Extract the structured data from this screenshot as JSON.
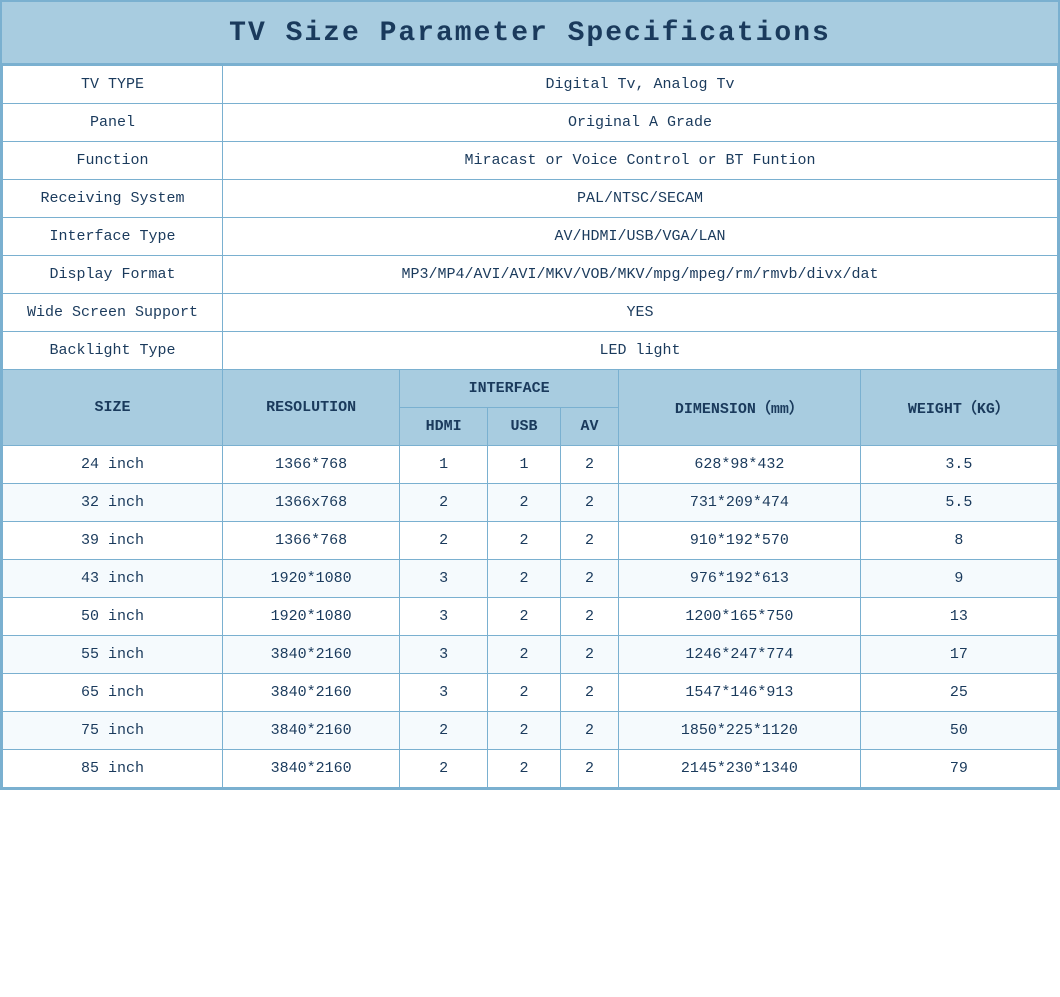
{
  "title": "TV Size Parameter Specifications",
  "specs": [
    {
      "label": "TV TYPE",
      "value": "Digital Tv, Analog Tv"
    },
    {
      "label": "Panel",
      "value": "Original A Grade"
    },
    {
      "label": "Function",
      "value": "Miracast or Voice Control or BT Funtion"
    },
    {
      "label": "Receiving System",
      "value": "PAL/NTSC/SECAM"
    },
    {
      "label": "Interface Type",
      "value": "AV/HDMI/USB/VGA/LAN"
    },
    {
      "label": "Display Format",
      "value": "MP3/MP4/AVI/AVI/MKV/VOB/MKV/mpg/mpeg/rm/rmvb/divx/dat"
    },
    {
      "label": "Wide Screen Support",
      "value": "YES"
    },
    {
      "label": "Backlight Type",
      "value": "LED light"
    }
  ],
  "size_table": {
    "col_size": "SIZE",
    "col_resolution": "RESOLUTION",
    "col_interface": "INTERFACE",
    "col_hdmi": "HDMI",
    "col_usb": "USB",
    "col_av": "AV",
    "col_dimension": "DIMENSION（mm）",
    "col_weight": "WEIGHT（KG）",
    "rows": [
      {
        "size": "24 inch",
        "resolution": "1366*768",
        "hdmi": "1",
        "usb": "1",
        "av": "2",
        "dimension": "628*98*432",
        "weight": "3.5"
      },
      {
        "size": "32 inch",
        "resolution": "1366x768",
        "hdmi": "2",
        "usb": "2",
        "av": "2",
        "dimension": "731*209*474",
        "weight": "5.5"
      },
      {
        "size": "39 inch",
        "resolution": "1366*768",
        "hdmi": "2",
        "usb": "2",
        "av": "2",
        "dimension": "910*192*570",
        "weight": "8"
      },
      {
        "size": "43 inch",
        "resolution": "1920*1080",
        "hdmi": "3",
        "usb": "2",
        "av": "2",
        "dimension": "976*192*613",
        "weight": "9"
      },
      {
        "size": "50 inch",
        "resolution": "1920*1080",
        "hdmi": "3",
        "usb": "2",
        "av": "2",
        "dimension": "1200*165*750",
        "weight": "13"
      },
      {
        "size": "55 inch",
        "resolution": "3840*2160",
        "hdmi": "3",
        "usb": "2",
        "av": "2",
        "dimension": "1246*247*774",
        "weight": "17"
      },
      {
        "size": "65 inch",
        "resolution": "3840*2160",
        "hdmi": "3",
        "usb": "2",
        "av": "2",
        "dimension": "1547*146*913",
        "weight": "25"
      },
      {
        "size": "75 inch",
        "resolution": "3840*2160",
        "hdmi": "2",
        "usb": "2",
        "av": "2",
        "dimension": "1850*225*1120",
        "weight": "50"
      },
      {
        "size": "85 inch",
        "resolution": "3840*2160",
        "hdmi": "2",
        "usb": "2",
        "av": "2",
        "dimension": "2145*230*1340",
        "weight": "79"
      }
    ]
  }
}
